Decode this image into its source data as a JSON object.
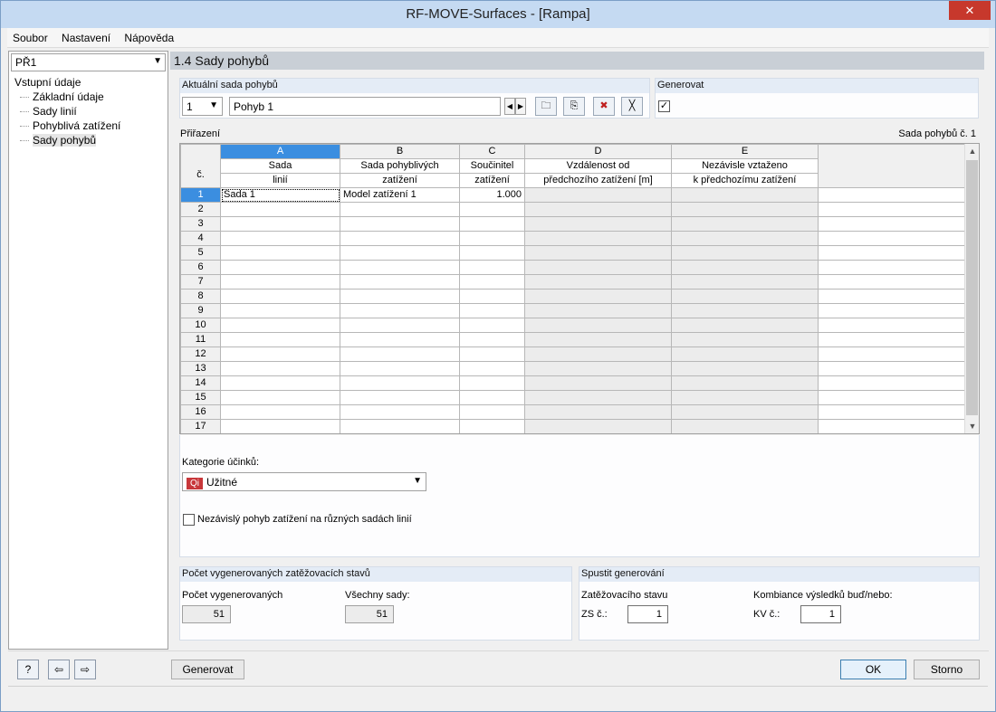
{
  "window": {
    "title": "RF-MOVE-Surfaces - [Rampa]",
    "close": "✕"
  },
  "menu": [
    {
      "label": "Soubor"
    },
    {
      "label": "Nastavení"
    },
    {
      "label": "Nápověda"
    }
  ],
  "nav": {
    "case": "PŘ1",
    "root": "Vstupní údaje",
    "items": [
      {
        "label": "Základní údaje"
      },
      {
        "label": "Sady linií"
      },
      {
        "label": "Pohyblivá zatížení"
      },
      {
        "label": "Sady pohybů",
        "selected": true
      }
    ]
  },
  "section_title": "1.4 Sady pohybů",
  "current_set": {
    "heading": "Aktuální sada pohybů",
    "number": "1",
    "name": "Pohyb 1"
  },
  "generate_group": {
    "heading": "Generovat",
    "checked": true,
    "check_mark": "✓"
  },
  "assignment": {
    "heading": "Přiřazení",
    "right_label": "Sada pohybů č. 1",
    "row_header_label": "č.",
    "columns": [
      {
        "letter": "A",
        "line1": "Sada",
        "line2": "linií"
      },
      {
        "letter": "B",
        "line1": "Sada pohyblivých",
        "line2": "zatížení"
      },
      {
        "letter": "C",
        "line1": "Součinitel",
        "line2": "zatížení"
      },
      {
        "letter": "D",
        "line1": "Vzdálenost od",
        "line2": "předchozího zatížení [m]"
      },
      {
        "letter": "E",
        "line1": "Nezávisle vztaženo",
        "line2": "k předchozímu zatížení"
      }
    ],
    "row_numbers": [
      "1",
      "2",
      "3",
      "4",
      "5",
      "6",
      "7",
      "8",
      "9",
      "10",
      "11",
      "12",
      "13",
      "14",
      "15",
      "16",
      "17"
    ],
    "row1": {
      "a": "Sada 1",
      "b": "Model zatížení 1",
      "c": "1.000"
    }
  },
  "category": {
    "label": "Kategorie účinků:",
    "badge": "Qi",
    "value": "Užitné"
  },
  "independent_checkbox": {
    "label": "Nezávislý pohyb zatížení na různých sadách linií",
    "checked": false
  },
  "count_group": {
    "heading": "Počet vygenerovaných zatěžovacích stavů",
    "generated_label": "Počet vygenerovaných",
    "generated_value": "51",
    "all_sets_label": "Všechny sady:",
    "all_sets_value": "51"
  },
  "start_group": {
    "heading": "Spustit generování",
    "lc_label": "Zatěžovacího stavu",
    "lc_prefix": "ZS č.:",
    "lc_value": "1",
    "co_label": "Kombiance výsledků buď/nebo:",
    "co_prefix": "KV č.:",
    "co_value": "1"
  },
  "buttons": {
    "generate": "Generovat",
    "ok": "OK",
    "cancel": "Storno"
  },
  "colors": {
    "selection": "#3b8ee0",
    "title_bg": "#c5daf2",
    "close": "#c7382c",
    "badge": "#c8373a"
  }
}
